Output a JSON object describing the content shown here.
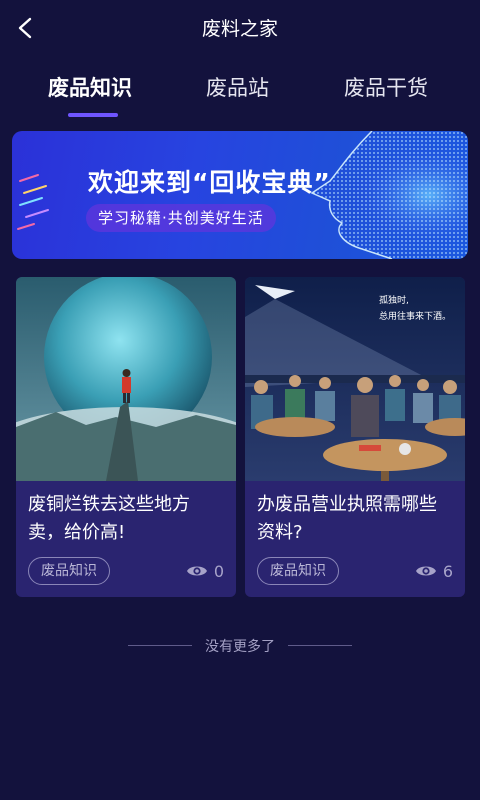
{
  "header": {
    "title": "废料之家",
    "back_icon": "chevron-left-icon"
  },
  "tabs": [
    {
      "label": "废品知识",
      "active": true
    },
    {
      "label": "废品站",
      "active": false
    },
    {
      "label": "废品干货",
      "active": false
    }
  ],
  "banner": {
    "title": "欢迎来到“回收宝典”",
    "subtitle": "学习秘籍·共创美好生活"
  },
  "cards": [
    {
      "title": "废铜烂铁去这些地方卖，给价高!",
      "tag": "废品知识",
      "views": "0",
      "image": "planet-illustration"
    },
    {
      "title": "办废品营业执照需哪些资料?",
      "tag": "废品知识",
      "views": "6",
      "image": "bar-crowd-illustration",
      "image_text_line1": "孤独时,",
      "image_text_line2": "总用往事来下酒。"
    }
  ],
  "footer": {
    "end_text": "没有更多了"
  },
  "colors": {
    "background": "#13123d",
    "card": "#2a2470",
    "accent": "#6f55ff"
  }
}
